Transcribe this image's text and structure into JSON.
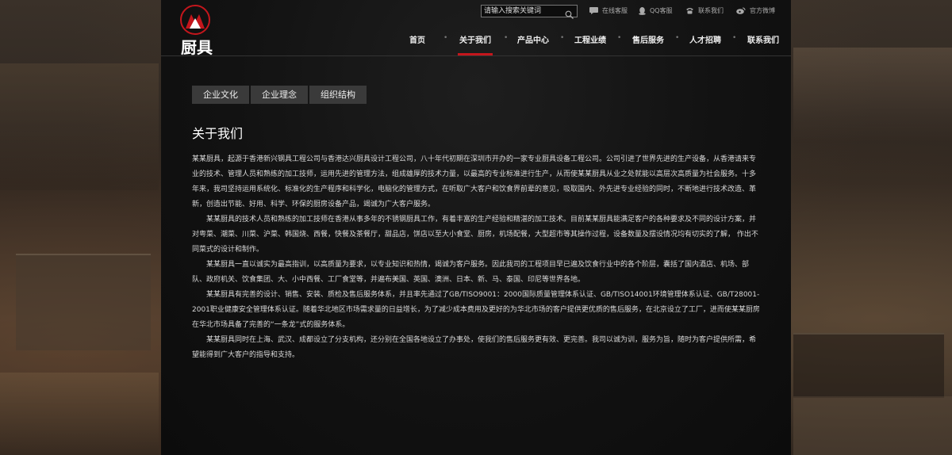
{
  "brand": {
    "logo_text": "厨具"
  },
  "search": {
    "placeholder": "请输入搜索关键词"
  },
  "toplinks": [
    {
      "label": "在线客服",
      "icon": "chat-icon"
    },
    {
      "label": "QQ客服",
      "icon": "qq-icon"
    },
    {
      "label": "联系我们",
      "icon": "phone-icon"
    },
    {
      "label": "官方微博",
      "icon": "weibo-icon"
    }
  ],
  "nav": [
    {
      "label": "首页"
    },
    {
      "label": "关于我们",
      "active": true
    },
    {
      "label": "产品中心"
    },
    {
      "label": "工程业绩"
    },
    {
      "label": "售后服务"
    },
    {
      "label": "人才招聘"
    },
    {
      "label": "联系我们"
    }
  ],
  "nav_separator": "•",
  "tabs": [
    {
      "label": "企业文化"
    },
    {
      "label": "企业理念"
    },
    {
      "label": "组织结构"
    }
  ],
  "page_title": "关于我们",
  "paragraphs": [
    "某某厨具，起源于香港新兴钢具工程公司与香港达兴厨具设计工程公司，八十年代初期在深圳市开办的一家专业厨具设备工程公司。公司引进了世界先进的生产设备，从香港请来专业的技术、管理人员和熟练的加工技师，运用先进的管理方法，组成雄厚的技术力量，以最高的专业标准进行生产，从而使某某厨具从业之处就能以高层次高质量为社会服务。十多年来，我司坚持运用系统化、标准化的生产程序和科学化，电脑化的管理方式，在听取广大客户和饮食界前辈的意见，吸取国内、外先进专业经验的同时，不断地进行技术改造、革新，创造出节能、好用、科学、环保的厨房设备产品，竭诚为广大客户服务。",
    "某某厨具的技术人员和熟练的加工技师在香港从事多年的不锈钢厨具工作，有着丰富的生产经验和精湛的加工技术。目前某某厨具能满足客户的各种要求及不同的设计方案，并对粤菜、潮菜、川菜、沪菜、韩国烧、西餐，快餐及茶餐厅，甜品店，饼店以至大小食堂、厨房，机场配餐，大型超市等其操作过程，设备数量及摆设情况均有切实的了解， 作出不同菜式的设计和制作。",
    "某某厨具一直以诚实为最高指训，以高质量为要求，以专业知识和热情，竭诚为客户服务。因此我司的工程项目早已遍及饮食行业中的各个阶层，囊括了国内酒店、机场、部队、政府机关、饮食集团、大、小中西餐、工厂食堂等，并遍布美国、英国、澳洲、日本、新、马、泰国、印尼等世界各地。",
    " 某某厨具有完善的设计、销售、安装、质检及售后服务体系，并且率先通过了GB/TISO9001：2000国际质量管理体系认证、GB/TISO14001环境管理体系认证、GB/T28001-2001职业健康安全管理体系认证。随着华北地区市场需求量的日益增长，为了减少成本费用及更好的为华北市场的客户提供更优质的售后服务，在北京设立了工厂，进而使某某厨房在华北市场具备了完善的“一条龙”式的服务体系。",
    "某某厨具同时在上海、武汉、成都设立了分支机构，还分别在全国各地设立了办事处，使我们的售后服务更有效、更完善。我司以诚为训，服务为旨，随时为客户提供所需，希望能得到广大客户的指导和支持。"
  ],
  "colors": {
    "accent": "#c4161c",
    "panel_bg": "#121212",
    "tab_bg": "#3a3a3a"
  }
}
